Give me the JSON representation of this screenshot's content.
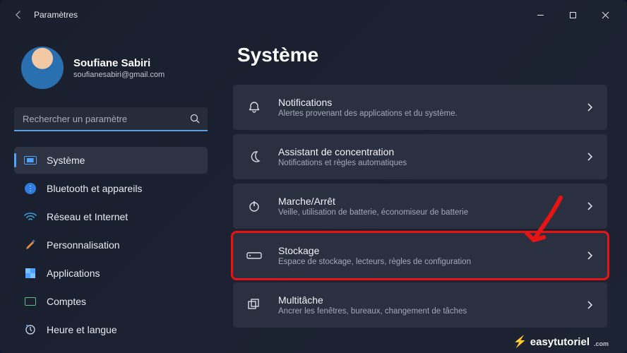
{
  "window": {
    "title": "Paramètres"
  },
  "user": {
    "name": "Soufiane Sabiri",
    "email": "soufianesabiri@gmail.com"
  },
  "search": {
    "placeholder": "Rechercher un paramètre"
  },
  "nav": {
    "system": "Système",
    "bluetooth": "Bluetooth et appareils",
    "network": "Réseau et Internet",
    "personalization": "Personnalisation",
    "apps": "Applications",
    "accounts": "Comptes",
    "time": "Heure et langue"
  },
  "page": {
    "heading": "Système"
  },
  "cards": {
    "notifications": {
      "title": "Notifications",
      "sub": "Alertes provenant des applications et du système."
    },
    "focus": {
      "title": "Assistant de concentration",
      "sub": "Notifications et règles automatiques"
    },
    "power": {
      "title": "Marche/Arrêt",
      "sub": "Veille, utilisation de batterie, économiseur de batterie"
    },
    "storage": {
      "title": "Stockage",
      "sub": "Espace de stockage, lecteurs, règles de configuration"
    },
    "multitask": {
      "title": "Multitâche",
      "sub": "Ancrer les fenêtres, bureaux, changement de tâches"
    }
  },
  "watermark": {
    "text": "easytutoriel",
    "suffix": ".com"
  }
}
